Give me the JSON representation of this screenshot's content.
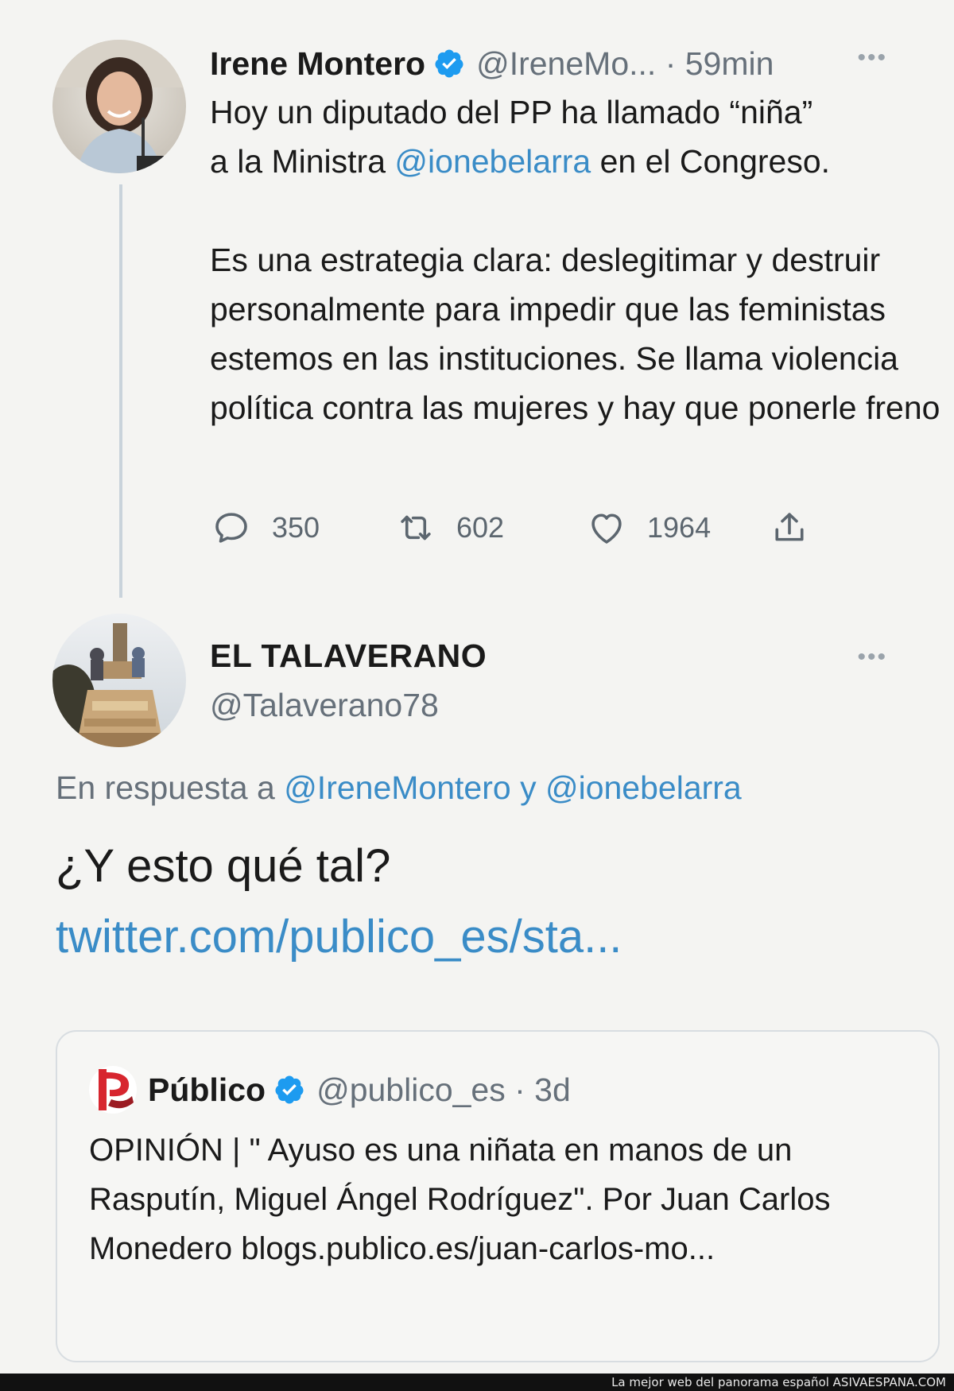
{
  "tweet1": {
    "author_name": "Irene Montero",
    "handle": "@IreneMo...",
    "time_sep": " · ",
    "time": "59min",
    "more_glyph": "•••",
    "body": {
      "line1_part1": "Hoy un diputado del PP ha llamado “niña”",
      "line2_part1": "a la Ministra ",
      "mention": "@ionebelarra",
      "line2_part2": " en el Congreso.",
      "paragraph2": "Es una estrategia clara: deslegitimar y destruir personalmente para impedir que las feministas estemos en las instituciones. Se llama violencia política contra las mujeres y hay que ponerle freno"
    },
    "actions": {
      "replies": "350",
      "retweets": "602",
      "likes": "1964"
    }
  },
  "tweet2": {
    "author_name": "EL TALAVERANO",
    "handle": "@Talaverano78",
    "more_glyph": "•••",
    "reply_prefix": "En respuesta a ",
    "reply_mention1": "@IreneMontero",
    "reply_and": " y ",
    "reply_mention2": "@ionebelarra",
    "text": "¿Y esto qué tal?",
    "link": "twitter.com/publico_es/sta..."
  },
  "quoted": {
    "author_name": "Público",
    "handle": "@publico_es",
    "time_sep": " · ",
    "time": "3d",
    "body": "OPINIÓN | \" Ayuso es una niñata en manos de un Rasputín, Miguel Ángel Rodríguez\". Por Juan Carlos Monedero blogs.publico.es/juan-carlos-mo..."
  },
  "footer": {
    "text": "La mejor web del panorama español ASIVAESPANA.COM"
  },
  "colors": {
    "link": "#3a8cc7",
    "verified": "#1d9bf0",
    "publico_red": "#d7262f",
    "secondary_text": "#66707a"
  },
  "icons": {
    "reply": "speech-bubble-icon",
    "retweet": "retweet-arrows-icon",
    "like": "heart-icon",
    "share": "share-upload-icon",
    "verified": "verified-badge-icon",
    "more": "more-dots-icon"
  }
}
